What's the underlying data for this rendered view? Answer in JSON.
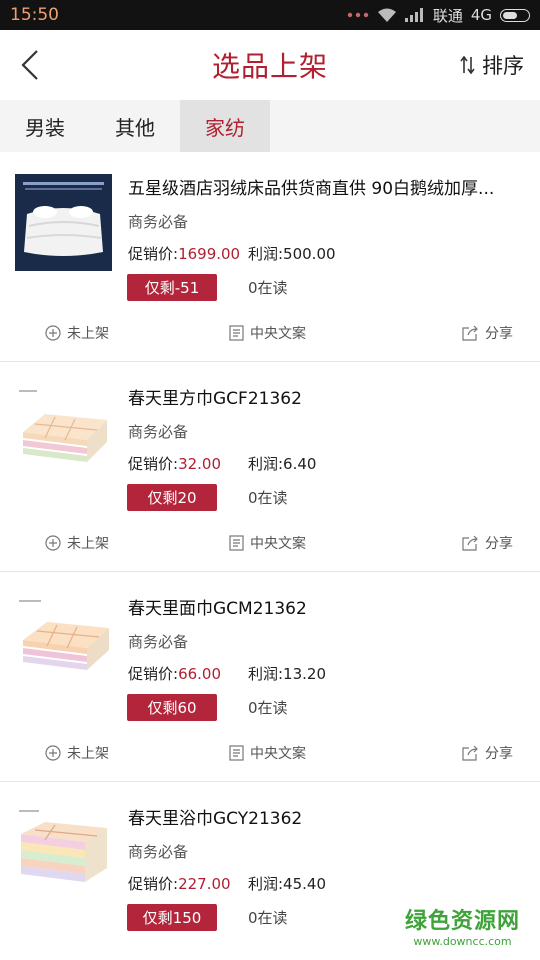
{
  "status_bar": {
    "time": "15:50",
    "carrier": "联通",
    "network": "4G"
  },
  "header": {
    "title": "选品上架",
    "sort_label": "排序"
  },
  "tabs": [
    {
      "label": "男装",
      "active": false
    },
    {
      "label": "其他",
      "active": false
    },
    {
      "label": "家纺",
      "active": true
    }
  ],
  "products": [
    {
      "name": "五星级酒店羽绒床品供货商直供 90白鹅绒加厚...",
      "subtitle": "商务必备",
      "promo_label": "促销价:",
      "promo_price": "1699.00",
      "profit": "利润:500.00",
      "stock": "仅剩-51",
      "reads": "0在读",
      "thumb": "duvet"
    },
    {
      "name": "春天里方巾GCF21362",
      "subtitle": "商务必备",
      "promo_label": "促销价:",
      "promo_price": "32.00",
      "profit": "利润:6.40",
      "stock": "仅剩20",
      "reads": "0在读",
      "thumb": "towel"
    },
    {
      "name": "春天里面巾GCM21362",
      "subtitle": "商务必备",
      "promo_label": "促销价:",
      "promo_price": "66.00",
      "profit": "利润:13.20",
      "stock": "仅剩60",
      "reads": "0在读",
      "thumb": "towel"
    },
    {
      "name": "春天里浴巾GCY21362",
      "subtitle": "商务必备",
      "promo_label": "促销价:",
      "promo_price": "227.00",
      "profit": "利润:45.40",
      "stock": "仅剩150",
      "reads": "0在读",
      "thumb": "towel-stack"
    }
  ],
  "actions": {
    "unlisted": "未上架",
    "central_copy": "中央文案",
    "share": "分享"
  },
  "watermark": {
    "main": "绿色资源网",
    "url": "www.downcc.com"
  },
  "colors": {
    "accent": "#b02030",
    "stock_badge": "#b3253a",
    "watermark": "#3fa33a"
  }
}
